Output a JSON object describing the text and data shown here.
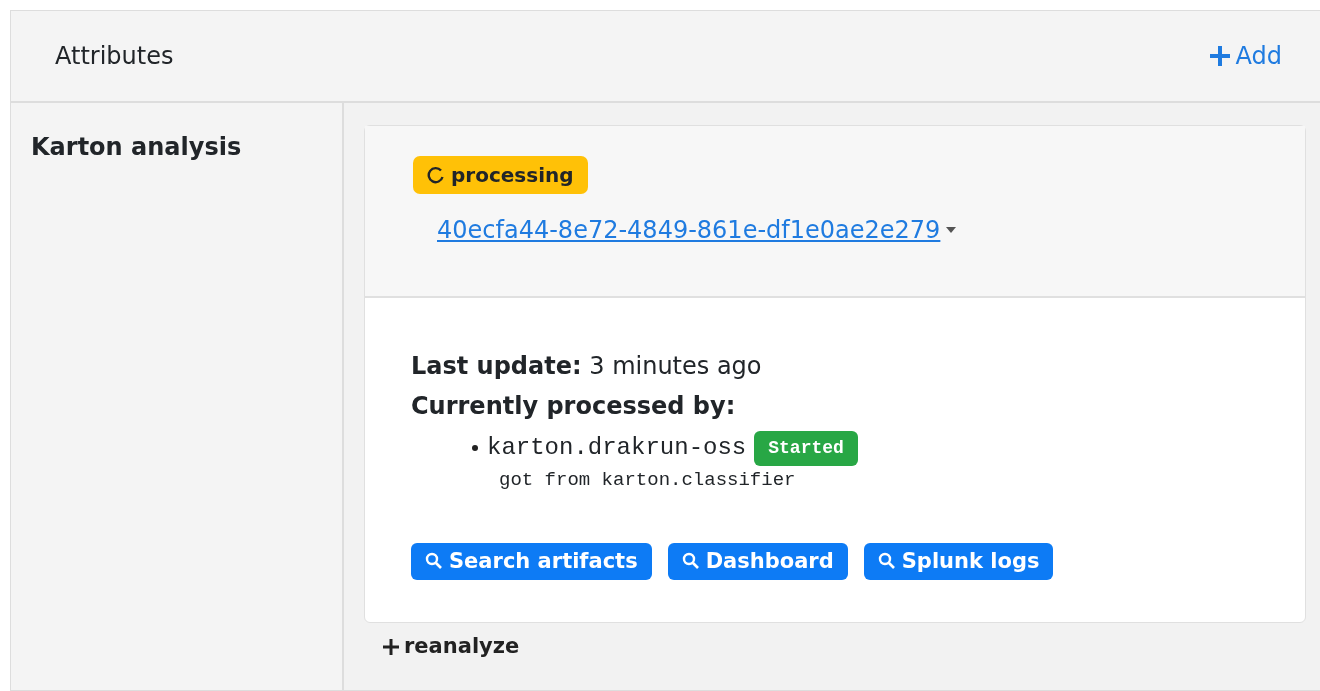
{
  "panel": {
    "title": "Attributes",
    "add_label": "Add"
  },
  "attribute": {
    "label": "Karton analysis",
    "status": {
      "label": "processing",
      "kind": "processing"
    },
    "analysis_id": "40ecfa44-8e72-4849-861e-df1e0ae2e279",
    "last_update_label": "Last update:",
    "last_update": "3 minutes ago",
    "processed_by_label": "Currently processed by:",
    "services": [
      {
        "name": "karton.drakrun-oss",
        "state": "Started",
        "kind": "success",
        "origin": "got from karton.classifier"
      }
    ],
    "buttons": [
      {
        "label": "Search artifacts"
      },
      {
        "label": "Dashboard"
      },
      {
        "label": "Splunk logs"
      }
    ],
    "reanalyze_label": "reanalyze"
  }
}
